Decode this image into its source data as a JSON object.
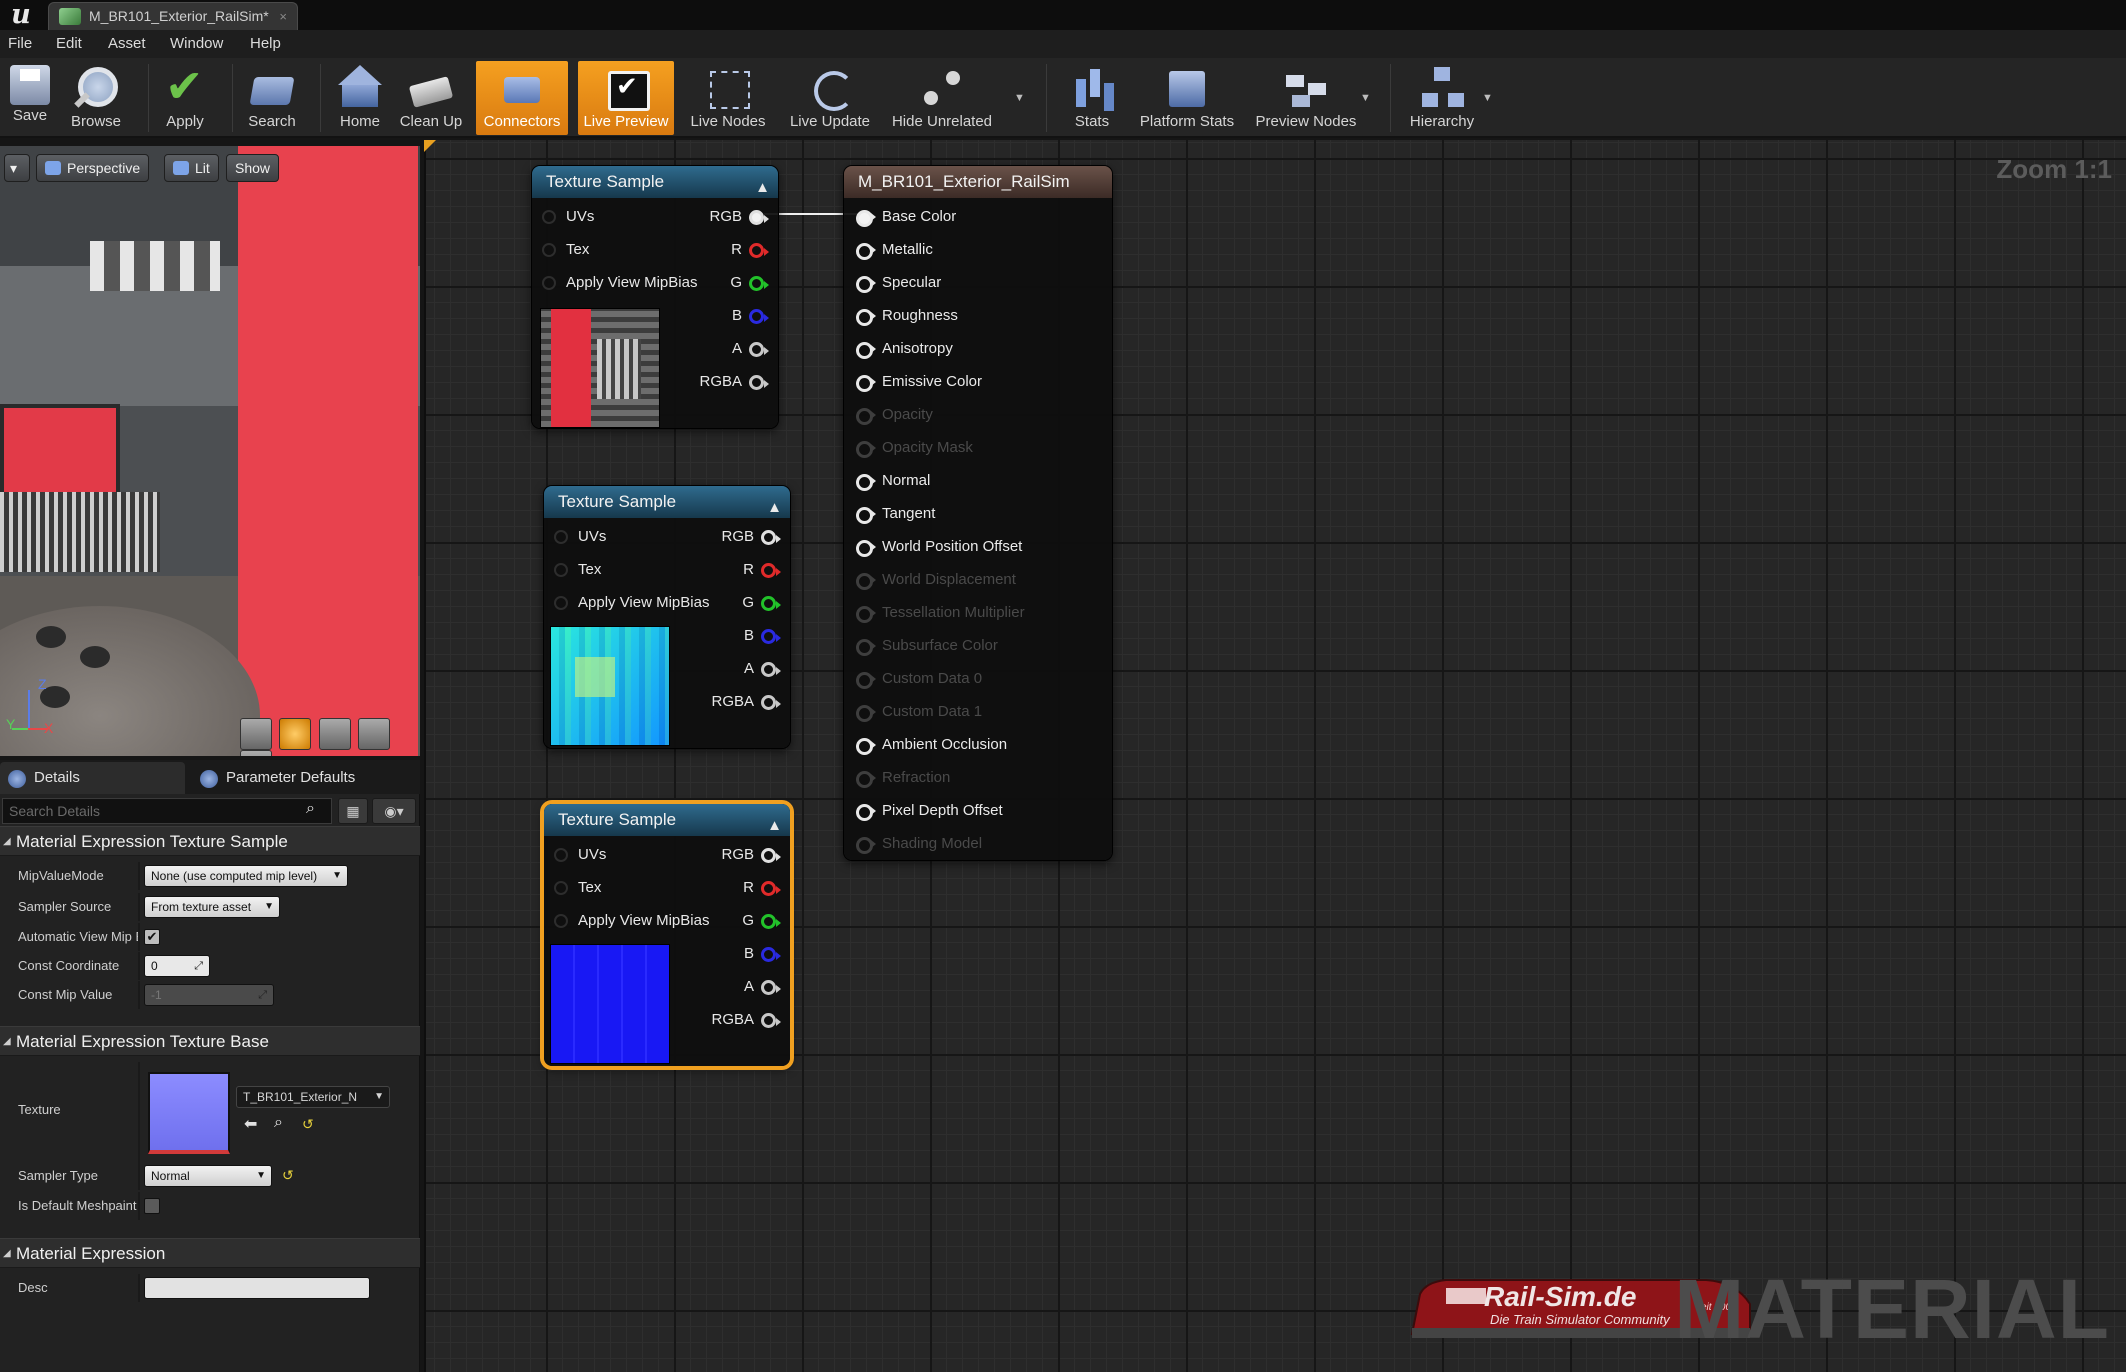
{
  "window": {
    "tab_title": "M_BR101_Exterior_RailSim*",
    "tab_close": "×",
    "logo": "u"
  },
  "menu": [
    "File",
    "Edit",
    "Asset",
    "Window",
    "Help"
  ],
  "toolbar": {
    "buttons": [
      {
        "label": "Save",
        "icon": "save-icon"
      },
      {
        "label": "Browse",
        "icon": "browse-icon"
      },
      {
        "label": "Apply",
        "icon": "apply-icon"
      },
      {
        "label": "Search",
        "icon": "search-icon"
      },
      {
        "label": "Home",
        "icon": "home-icon"
      },
      {
        "label": "Clean Up",
        "icon": "cleanup-icon"
      },
      {
        "label": "Connectors",
        "icon": "connectors-icon",
        "active": true
      },
      {
        "label": "Live Preview",
        "icon": "live-preview-icon",
        "active": true
      },
      {
        "label": "Live Nodes",
        "icon": "live-nodes-icon"
      },
      {
        "label": "Live Update",
        "icon": "live-update-icon"
      },
      {
        "label": "Hide Unrelated",
        "icon": "hide-unrelated-icon"
      },
      {
        "label": "Stats",
        "icon": "stats-icon"
      },
      {
        "label": "Platform Stats",
        "icon": "platform-stats-icon"
      },
      {
        "label": "Preview Nodes",
        "icon": "preview-nodes-icon"
      },
      {
        "label": "Hierarchy",
        "icon": "hierarchy-icon"
      }
    ],
    "accent_color": "#f29a1e"
  },
  "viewport": {
    "menu_caret": "▾",
    "perspective": "Perspective",
    "lit": "Lit",
    "show": "Show",
    "axis": {
      "z": "Z",
      "x": "X",
      "y": "Y"
    }
  },
  "details": {
    "tab_details": "Details",
    "tab_params": "Parameter Defaults",
    "search_placeholder": "Search Details",
    "section_texture_sample": "Material Expression Texture Sample",
    "mip_value_mode_label": "MipValueMode",
    "mip_value_mode_value": "None (use computed mip level)",
    "sampler_source_label": "Sampler Source",
    "sampler_source_value": "From texture asset",
    "auto_view_mip_label": "Automatic View Mip Bias",
    "auto_view_mip_checked": true,
    "const_coord_label": "Const Coordinate",
    "const_coord_value": "0",
    "const_mip_label": "Const Mip Value",
    "const_mip_value": "-1",
    "section_texture_base": "Material Expression Texture Base",
    "texture_label": "Texture",
    "texture_asset": "T_BR101_Exterior_N",
    "sampler_type_label": "Sampler Type",
    "sampler_type_value": "Normal",
    "default_meshpaint_label": "Is Default Meshpaint Texture",
    "default_meshpaint_checked": false,
    "section_expression": "Material Expression",
    "desc_label": "Desc",
    "desc_value": ""
  },
  "graph": {
    "zoom": "Zoom 1:1",
    "watermark": "MATERIAL",
    "brand": {
      "name": "Rail-Sim.de",
      "tagline": "Die Train Simulator Community",
      "since": "seit 2007"
    },
    "texture_nodes": [
      {
        "title": "Texture Sample",
        "inputs": [
          "UVs",
          "Tex",
          "Apply View MipBias"
        ],
        "outputs": [
          "RGB",
          "R",
          "G",
          "B",
          "A",
          "RGBA"
        ],
        "rgb_connected": true,
        "selected": false
      },
      {
        "title": "Texture Sample",
        "inputs": [
          "UVs",
          "Tex",
          "Apply View MipBias"
        ],
        "outputs": [
          "RGB",
          "R",
          "G",
          "B",
          "A",
          "RGBA"
        ],
        "rgb_connected": false,
        "selected": false
      },
      {
        "title": "Texture Sample",
        "inputs": [
          "UVs",
          "Tex",
          "Apply View MipBias"
        ],
        "outputs": [
          "RGB",
          "R",
          "G",
          "B",
          "A",
          "RGBA"
        ],
        "rgb_connected": false,
        "selected": true
      }
    ],
    "material_node": {
      "title": "M_BR101_Exterior_RailSim",
      "pins": [
        {
          "label": "Base Color",
          "enabled": true,
          "connected": true
        },
        {
          "label": "Metallic",
          "enabled": true
        },
        {
          "label": "Specular",
          "enabled": true
        },
        {
          "label": "Roughness",
          "enabled": true
        },
        {
          "label": "Anisotropy",
          "enabled": true
        },
        {
          "label": "Emissive Color",
          "enabled": true
        },
        {
          "label": "Opacity",
          "enabled": false
        },
        {
          "label": "Opacity Mask",
          "enabled": false
        },
        {
          "label": "Normal",
          "enabled": true
        },
        {
          "label": "Tangent",
          "enabled": true
        },
        {
          "label": "World Position Offset",
          "enabled": true
        },
        {
          "label": "World Displacement",
          "enabled": false
        },
        {
          "label": "Tessellation Multiplier",
          "enabled": false
        },
        {
          "label": "Subsurface Color",
          "enabled": false
        },
        {
          "label": "Custom Data 0",
          "enabled": false
        },
        {
          "label": "Custom Data 1",
          "enabled": false
        },
        {
          "label": "Ambient Occlusion",
          "enabled": true
        },
        {
          "label": "Refraction",
          "enabled": false
        },
        {
          "label": "Pixel Depth Offset",
          "enabled": true
        },
        {
          "label": "Shading Model",
          "enabled": false
        }
      ]
    }
  }
}
